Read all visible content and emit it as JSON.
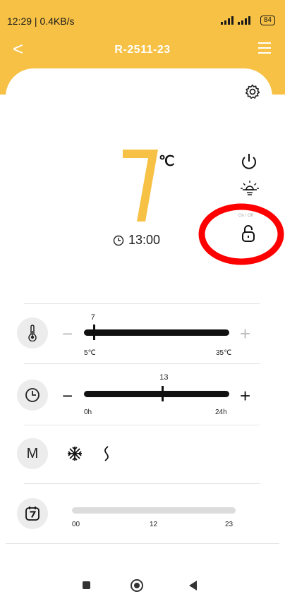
{
  "status_bar": {
    "time_speed": "12:29 | 0.4KB/s",
    "battery": "84"
  },
  "header": {
    "title": "R-2511-23",
    "bg_color": "#f6c144"
  },
  "display": {
    "temperature": "7",
    "unit": "℃",
    "timer": "13:00",
    "accent_color": "#f6c144"
  },
  "controls": {
    "on_off_label": "On / Off",
    "highlight_color": "#ff0000"
  },
  "temperature_slider": {
    "value": "7",
    "min_label": "5℃",
    "max_label": "35℃",
    "minus": "−",
    "plus": "+",
    "value_fraction": 0.067
  },
  "timer_slider": {
    "value": "13",
    "min_label": "0h",
    "max_label": "24h",
    "minus": "−",
    "plus": "+",
    "value_fraction": 0.54
  },
  "mode_row": {
    "label": "M",
    "icons": [
      "snowflake-icon",
      "heat-wave-icon"
    ]
  },
  "schedule": {
    "ticks": [
      "00",
      "12",
      "23"
    ]
  },
  "icons": [
    "back-icon",
    "menu-icon",
    "settings-gear-icon",
    "power-icon",
    "light-bulb-icon",
    "lock-icon",
    "thermometer-icon",
    "clock-icon",
    "calendar-seven-icon"
  ]
}
